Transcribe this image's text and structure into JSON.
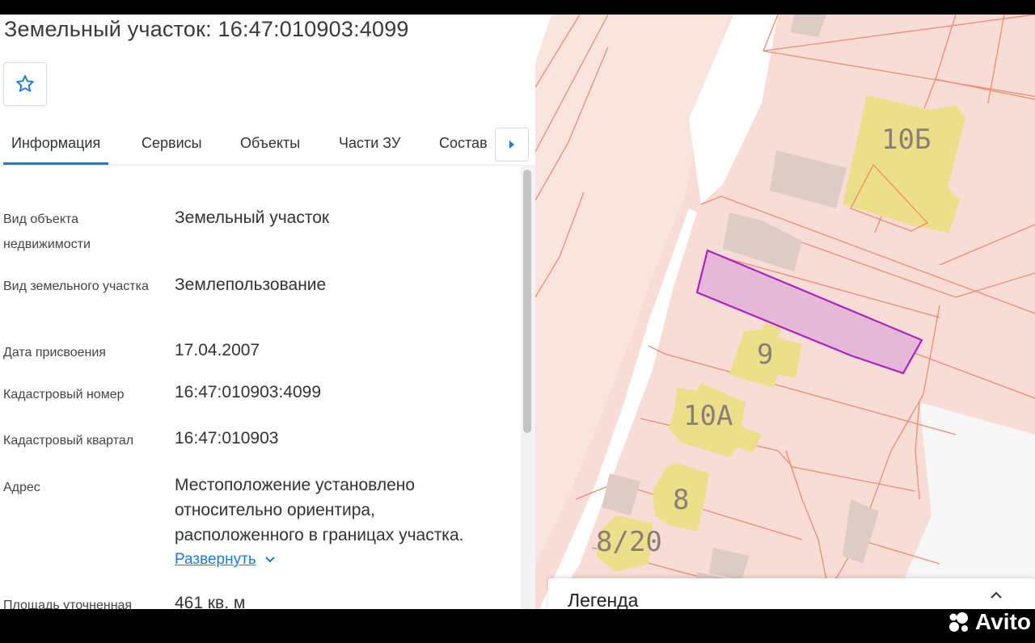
{
  "header": {
    "title": "Земельный участок: 16:47:010903:4099"
  },
  "tabs": [
    {
      "label": "Информация",
      "active": true
    },
    {
      "label": "Сервисы"
    },
    {
      "label": "Объекты"
    },
    {
      "label": "Части ЗУ"
    },
    {
      "label": "Состав"
    }
  ],
  "info": {
    "object_type_label": "Вид объекта недвижимости",
    "object_type_value": "Земельный участок",
    "land_type_label": "Вид земельного участка",
    "land_type_value": "Землепользование",
    "date_label": "Дата присвоения",
    "date_value": "17.04.2007",
    "cad_number_label": "Кадастровый номер",
    "cad_number_value": "16:47:010903:4099",
    "cad_quarter_label": "Кадастровый квартал",
    "cad_quarter_value": "16:47:010903",
    "address_label": "Адрес",
    "address_value": "Местоположение установлено относительно ориентира, расположенного в границах участка.",
    "expand_label": "Развернуть",
    "area_label": "Площадь уточненная",
    "area_value": "461 кв. м"
  },
  "map": {
    "building_labels": [
      "10Б",
      "9",
      "10А",
      "8",
      "8/20"
    ],
    "legend_title": "Легенда"
  },
  "watermark": "Avito",
  "colors": {
    "accent": "#1e7ad6",
    "parcel_fill": "#f8dcd6",
    "parcel_line": "#ef8a73",
    "building": "#ecdf8a",
    "selected": "#b01fc0"
  }
}
